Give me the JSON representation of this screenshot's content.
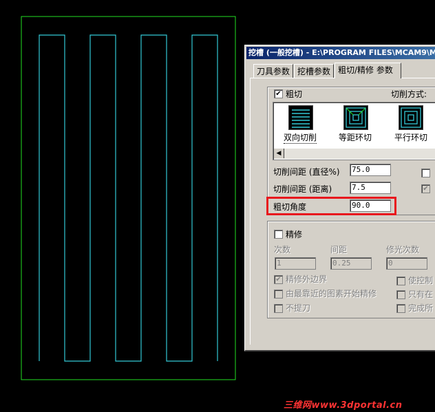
{
  "dialog": {
    "title": "挖槽 (一般挖槽) - E:\\PROGRAM FILES\\MCAM9\\M",
    "tabs": [
      "刀具参数",
      "挖槽参数",
      "粗切/精修 参数"
    ]
  },
  "rough": {
    "enabled_label": "粗切",
    "cut_method_label": "切削方式:",
    "methods": [
      "双向切削",
      "等距环切",
      "平行环切"
    ],
    "stepover_pct_label": "切削间距 (直径%)",
    "stepover_pct_value": "75.0",
    "stepover_dist_label": "切削间距 (距离)",
    "stepover_dist_value": "7.5",
    "angle_label": "粗切角度",
    "angle_value": "90.0"
  },
  "finish": {
    "enabled_label": "精修",
    "passes_label": "次数",
    "spacing_label": "间距",
    "spring_label": "修光次数",
    "passes_value": "1",
    "spacing_value": "0.25",
    "spring_value": "0",
    "outer_boundary_label": "精修外边界",
    "nearest_start_label": "由最靠近的图素开始精修",
    "no_lift_label": "不提刀",
    "control_label": "使控制",
    "only_label": "只有在",
    "complete_label": "完成所"
  },
  "watermark": "三维网www.3dportal.cn",
  "colors": {
    "toolpath": "#33c9d6",
    "boundary": "#22e022",
    "highlight": "#e8161d"
  }
}
